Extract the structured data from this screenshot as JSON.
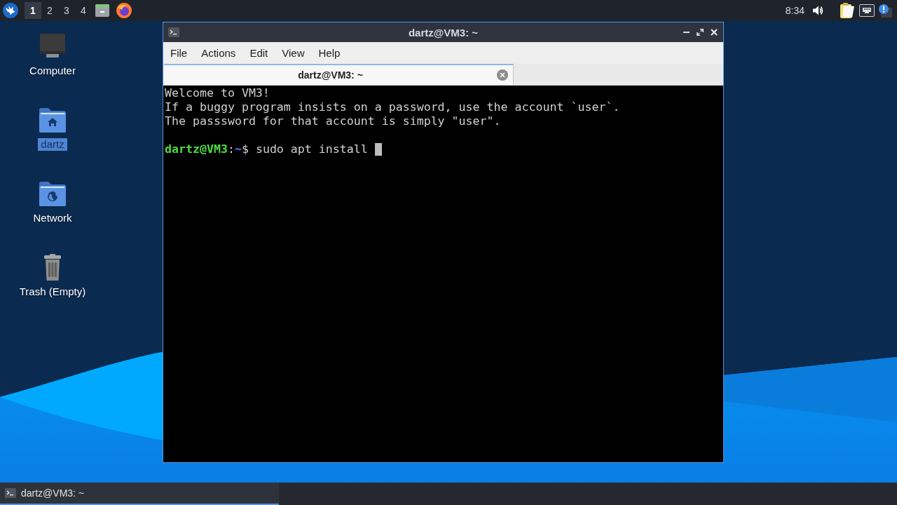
{
  "top_panel": {
    "workspaces": [
      {
        "label": "1",
        "selected": true
      },
      {
        "label": "2",
        "selected": false
      },
      {
        "label": "3",
        "selected": false
      },
      {
        "label": "4",
        "selected": false
      }
    ],
    "clock": "8:34"
  },
  "desktop_icons": [
    {
      "label": "Computer",
      "kind": "computer",
      "selected": false
    },
    {
      "label": "dartz",
      "kind": "home",
      "selected": true
    },
    {
      "label": "Network",
      "kind": "network",
      "selected": false
    },
    {
      "label": "Trash (Empty)",
      "kind": "trash",
      "selected": false
    }
  ],
  "window": {
    "title": "dartz@VM3: ~",
    "menu": [
      "File",
      "Actions",
      "Edit",
      "View",
      "Help"
    ],
    "tabs": [
      {
        "label": "dartz@VM3: ~",
        "selected": true
      }
    ],
    "terminal": {
      "lines": [
        "Welcome to VM3!",
        "If a buggy program insists on a password, use the account `user`.",
        "The passsword for that account is simply \"user\"."
      ],
      "prompt": {
        "user_host": "dartz@VM3",
        "separator": ":",
        "path": "~",
        "symbol": "$",
        "command": "sudo apt install"
      },
      "cursor": true
    }
  },
  "taskbar": {
    "items": [
      {
        "label": "dartz@VM3: ~",
        "active": true
      }
    ]
  }
}
